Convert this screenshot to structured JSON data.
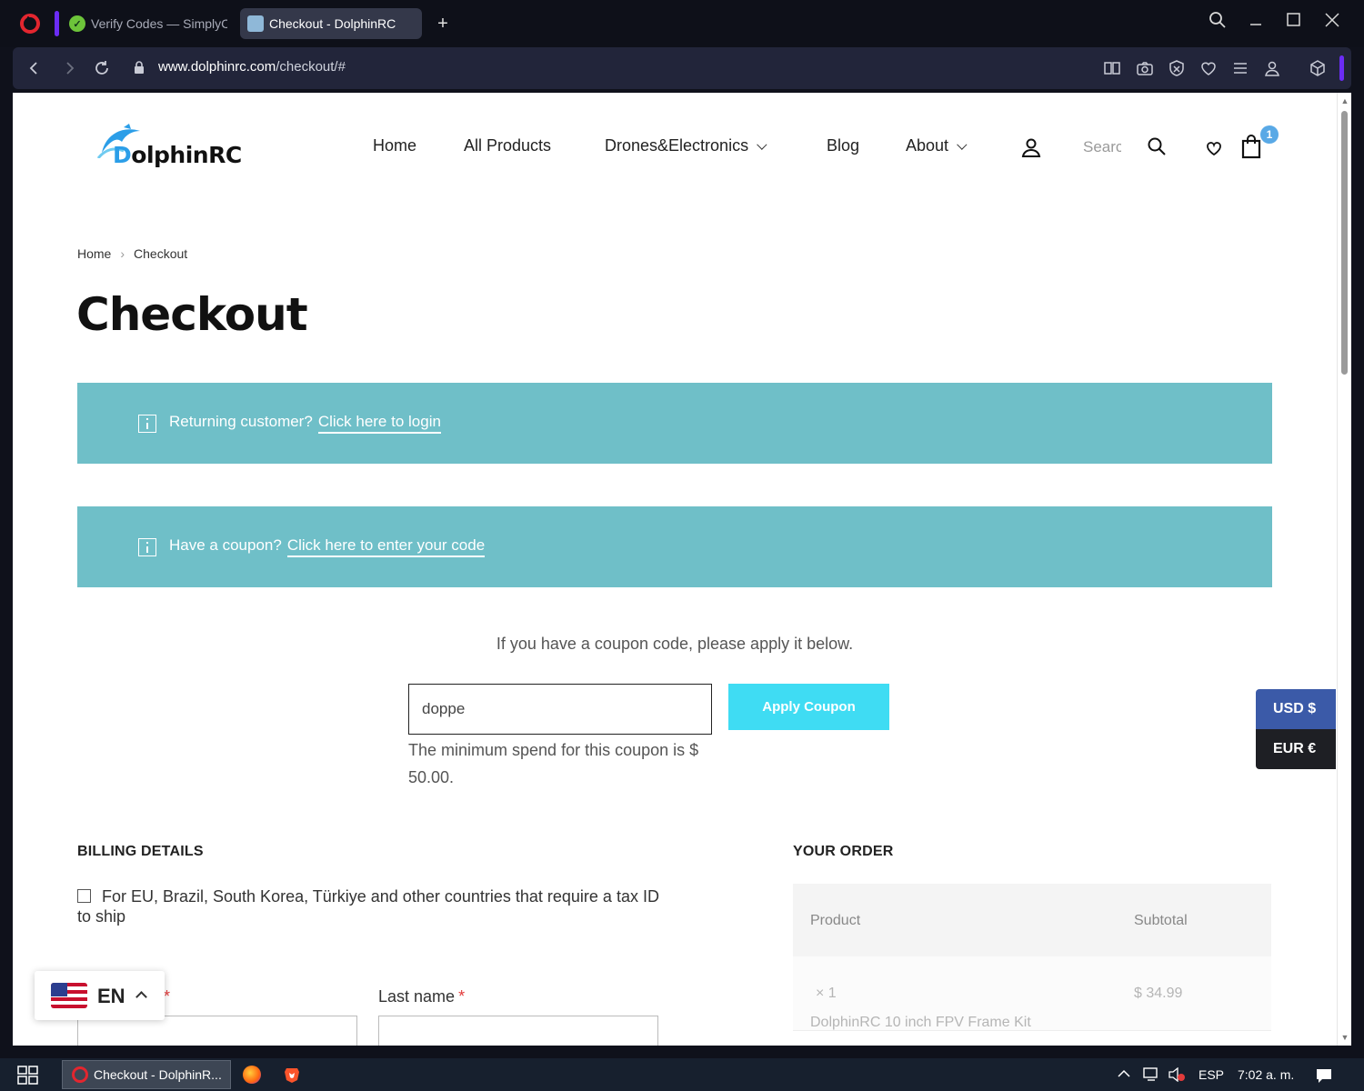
{
  "browser": {
    "tabs": [
      {
        "label": "Verify Codes — SimplyCodes",
        "active": false
      },
      {
        "label": "Checkout - DolphinRC",
        "active": true
      }
    ],
    "url_host": "www.dolphinrc.com",
    "url_path": "/checkout/#"
  },
  "header": {
    "logo_text_d": "D",
    "logo_text_rest": "olphinRC",
    "nav": [
      "Home",
      "All Products",
      "Drones&Electronics",
      "Blog",
      "About"
    ],
    "search_placeholder": "Search",
    "cart_count": "1"
  },
  "breadcrumb": {
    "home": "Home",
    "current": "Checkout"
  },
  "page_title": "Checkout",
  "notices": {
    "login_prefix": "Returning customer?",
    "login_link": "Click here to login",
    "coupon_prefix": "Have a coupon?",
    "coupon_link": "Click here to enter your code"
  },
  "coupon": {
    "hint": "If you have a coupon code, please apply it below.",
    "value": "doppe",
    "apply_label": "Apply Coupon",
    "error": "The minimum spend for this coupon is $ 50.00."
  },
  "billing": {
    "heading": "BILLING DETAILS",
    "tax_id_label": "For EU, Brazil, South Korea, Türkiye and other countries that require a tax ID to ship",
    "last_name_label": "Last name",
    "required_mark": "*"
  },
  "order": {
    "heading": "YOUR ORDER",
    "col_product": "Product",
    "col_subtotal": "Subtotal",
    "items": [
      {
        "name": "DolphinRC 10 inch FPV Frame Kit",
        "qty": "× 1",
        "subtotal": "$ 34.99"
      }
    ]
  },
  "currency": {
    "usd": "USD $",
    "eur": "EUR €"
  },
  "language": {
    "code": "EN"
  },
  "taskbar": {
    "app_label": "Checkout - DolphinR...",
    "lang": "ESP",
    "time": "7:02 a. m."
  },
  "colors": {
    "notice_bg": "#6fbfc8",
    "apply_button": "#3fdcf3",
    "usd_bg": "#3b5aa8",
    "eur_bg": "#1e1f24",
    "cart_badge": "#59a9e6",
    "required": "#e23b3b"
  }
}
